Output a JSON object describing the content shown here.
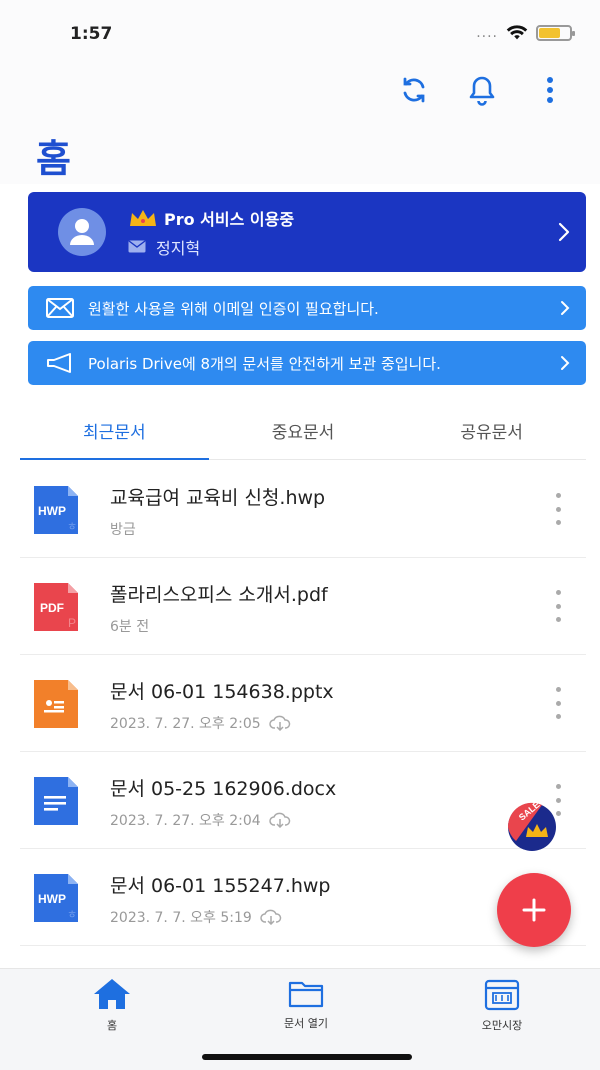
{
  "status_bar": {
    "time": "1:57",
    "signal": "....",
    "battery_color": "#f2c230"
  },
  "header": {
    "title": "홈",
    "actions": [
      "refresh-icon",
      "bell-icon",
      "more-vertical-icon"
    ]
  },
  "pro_card": {
    "service_label": "Pro 서비스 이용중",
    "user_name": "정지혁",
    "background": "#1b36c2"
  },
  "banners": {
    "email": "원활한 사용을 위해 이메일 인증이 필요합니다.",
    "drive": "Polaris Drive에 8개의 문서를 안전하게 보관 중입니다."
  },
  "tabs": [
    {
      "label": "최근문서",
      "active": true
    },
    {
      "label": "중요문서",
      "active": false
    },
    {
      "label": "공유문서",
      "active": false
    }
  ],
  "documents": [
    {
      "name": "교육급여 교육비 신청.hwp",
      "meta": "방금",
      "type": "hwp",
      "icon_color": "#2f6fe0",
      "cloud": false
    },
    {
      "name": "폴라리스오피스 소개서.pdf",
      "meta": "6분 전",
      "type": "pdf",
      "icon_color": "#e9454d",
      "cloud": false
    },
    {
      "name": "문서 06-01 154638.pptx",
      "meta": "2023. 7. 27. 오후 2:05",
      "type": "pptx",
      "icon_color": "#f2802a",
      "cloud": true
    },
    {
      "name": "문서 05-25 162906.docx",
      "meta": "2023. 7. 27. 오후 2:04",
      "type": "docx",
      "icon_color": "#2f6fe0",
      "cloud": true
    },
    {
      "name": "문서 06-01 155247.hwp",
      "meta": "2023. 7. 7. 오후 5:19",
      "type": "hwp",
      "icon_color": "#2f6fe0",
      "cloud": true
    }
  ],
  "file_icon_labels": {
    "hwp": "HWP",
    "pdf": "PDF"
  },
  "sale_badge": {
    "text": "SALE"
  },
  "fab": {
    "symbol": "+",
    "color": "#ef3e4a"
  },
  "bottom_nav": [
    {
      "label": "홈",
      "icon": "home-icon",
      "active": true
    },
    {
      "label": "문서 열기",
      "icon": "folder-icon",
      "active": false
    },
    {
      "label": "오만시장",
      "icon": "store-icon",
      "active": false
    }
  ]
}
